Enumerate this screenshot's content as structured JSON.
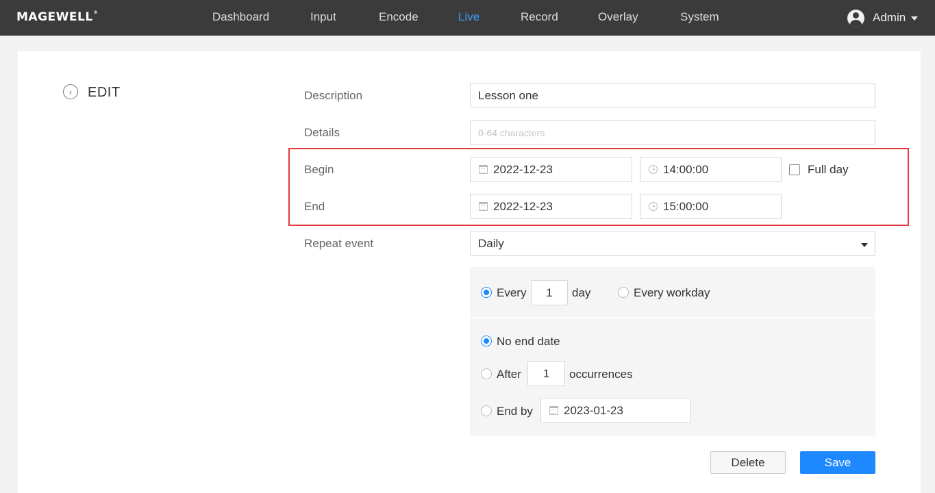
{
  "brand": {
    "logo": "MAGEWELL",
    "trademark": "®"
  },
  "nav": {
    "items": [
      {
        "label": "Dashboard",
        "active": false
      },
      {
        "label": "Input",
        "active": false
      },
      {
        "label": "Encode",
        "active": false
      },
      {
        "label": "Live",
        "active": true
      },
      {
        "label": "Record",
        "active": false
      },
      {
        "label": "Overlay",
        "active": false
      },
      {
        "label": "System",
        "active": false
      }
    ],
    "user": {
      "name": "Admin",
      "icon": "user-avatar-icon"
    },
    "active_color": "#3d9bff"
  },
  "page": {
    "title": "EDIT",
    "back_icon": "chevron-left-circle-icon"
  },
  "form": {
    "description": {
      "label": "Description",
      "value": "Lesson one"
    },
    "details": {
      "label": "Details",
      "value": "",
      "placeholder": "0-64 characters"
    },
    "begin": {
      "label": "Begin",
      "date": "2022-12-23",
      "time": "14:00:00"
    },
    "end": {
      "label": "End",
      "date": "2022-12-23",
      "time": "15:00:00"
    },
    "full_day": {
      "label": "Full day",
      "checked": false
    },
    "repeat": {
      "label": "Repeat event",
      "selected": "Daily"
    },
    "frequency": {
      "every_label": "Every",
      "every_value": "1",
      "unit_label": "day",
      "every_checked": true,
      "workday_label": "Every workday",
      "workday_checked": false
    },
    "range": {
      "no_end_label": "No end date",
      "no_end_checked": true,
      "after_label": "After",
      "after_value": "1",
      "occurrences_label": "occurrences",
      "after_checked": false,
      "end_by_label": "End by",
      "end_by_date": "2023-01-23",
      "end_by_checked": false
    }
  },
  "actions": {
    "delete_label": "Delete",
    "save_label": "Save"
  },
  "colors": {
    "accent": "#1e88ff",
    "highlight_border": "#e0393e",
    "nav_bg": "#3b3b3b"
  }
}
